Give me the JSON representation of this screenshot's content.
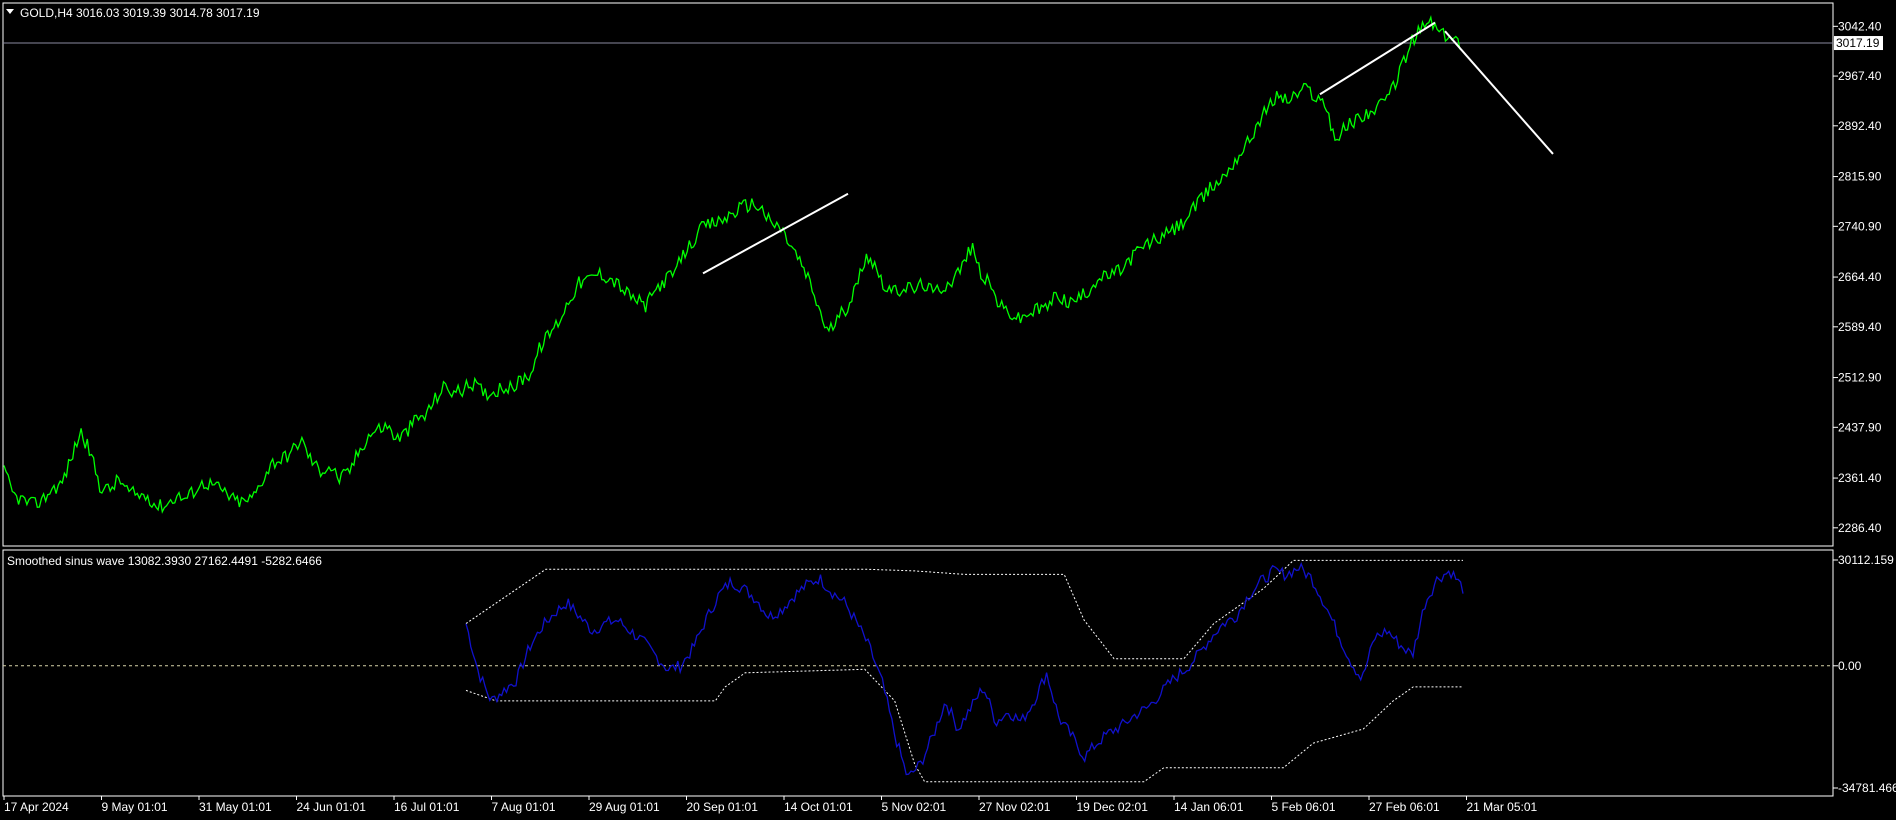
{
  "colors": {
    "background": "#000000",
    "price_line": "#00ff00",
    "indicator_line": "#1111cc",
    "band": "#ffffff",
    "grid_frame": "#ffffff",
    "zero_line": "#d6d2a8",
    "trendline": "#ffffff"
  },
  "main_panel": {
    "header": "GOLD,H4  3016.03 3019.39 3014.78 3017.19",
    "current_price": "3017.19",
    "y_ticks": [
      "3042.40",
      "2967.40",
      "2892.40",
      "2815.90",
      "2740.90",
      "2664.40",
      "2589.40",
      "2512.90",
      "2437.90",
      "2361.40",
      "2286.40"
    ]
  },
  "indicator_panel": {
    "header": "Smoothed sinus wave 13082.3930 27162.4491 -5282.6466",
    "y_ticks": [
      "30112.159",
      "0.00",
      "-34781.466"
    ]
  },
  "x_ticks": [
    "17 Apr 2024",
    "9 May 01:01",
    "31 May 01:01",
    "24 Jun 01:01",
    "16 Jul 01:01",
    "7 Aug 01:01",
    "29 Aug 01:01",
    "20 Sep 01:01",
    "14 Oct 01:01",
    "5 Nov 02:01",
    "27 Nov 02:01",
    "19 Dec 02:01",
    "14 Jan 06:01",
    "5 Feb 06:01",
    "27 Feb 06:01",
    "21 Mar 05:01"
  ],
  "chart_data": [
    {
      "type": "line",
      "title": "GOLD,H4",
      "x": [
        "17 Apr 2024",
        "9 May 01:01",
        "31 May 01:01",
        "24 Jun 01:01",
        "16 Jul 01:01",
        "7 Aug 01:01",
        "29 Aug 01:01",
        "20 Sep 01:01",
        "14 Oct 01:01",
        "5 Nov 02:01",
        "27 Nov 02:01",
        "19 Dec 02:01",
        "14 Jan 06:01",
        "5 Feb 06:01",
        "27 Feb 06:01",
        "21 Mar 05:01"
      ],
      "ylim": [
        2262,
        3070
      ],
      "series": [
        {
          "values": [
            2372,
            2335,
            2328,
            2321,
            2328,
            2345,
            2352,
            2390,
            2432,
            2400,
            2350,
            2343,
            2360,
            2340,
            2335,
            2335,
            2318,
            2322,
            2335,
            2330,
            2345,
            2355,
            2350,
            2340,
            2328,
            2325,
            2332,
            2360,
            2385,
            2390,
            2400,
            2420,
            2390,
            2372,
            2380,
            2360,
            2370,
            2400,
            2425,
            2435,
            2440,
            2420,
            2430,
            2450,
            2455,
            2480,
            2500,
            2490,
            2495,
            2505,
            2490,
            2490,
            2500,
            2495,
            2510,
            2520,
            2560,
            2580,
            2600,
            2630,
            2655,
            2660,
            2670,
            2665,
            2655,
            2640,
            2630,
            2620,
            2645,
            2660,
            2670,
            2700,
            2720,
            2740,
            2745,
            2750,
            2760,
            2770,
            2775,
            2770,
            2745,
            2740,
            2715,
            2690,
            2660,
            2620,
            2580,
            2600,
            2620,
            2650,
            2700,
            2680,
            2650,
            2640,
            2650,
            2645,
            2655,
            2640,
            2650,
            2660,
            2680,
            2710,
            2670,
            2650,
            2620,
            2610,
            2600,
            2610,
            2615,
            2620,
            2640,
            2625,
            2630,
            2640,
            2660,
            2665,
            2670,
            2680,
            2700,
            2710,
            2720,
            2725,
            2735,
            2745,
            2765,
            2780,
            2800,
            2810,
            2830,
            2850,
            2870,
            2900,
            2920,
            2940,
            2930,
            2940,
            2950,
            2935,
            2925,
            2870,
            2890,
            2900,
            2910,
            2915,
            2925,
            2950,
            2985,
            3020,
            3040,
            3050,
            3030,
            3025,
            3017
          ]
        }
      ],
      "trendlines": [
        {
          "from": [
            "20 Sep 01:01",
            2670
          ],
          "to": [
            "14 Oct 01:01",
            2790
          ]
        },
        {
          "from": [
            "5 Feb 06:01",
            2940
          ],
          "to": [
            "21 Mar 05:01",
            3048
          ]
        },
        {
          "from": [
            "21 Mar 05:01",
            3035
          ],
          "to": [
            "",
            2850
          ]
        }
      ],
      "current_value": 3017.19
    },
    {
      "type": "line",
      "title": "Smoothed sinus wave",
      "ylim": [
        -34781.466,
        30112.159
      ],
      "zero_line": 0,
      "series": [
        {
          "name": "Smoothed sinus wave",
          "values": [
            12000,
            -2000,
            -10000,
            -7000,
            -4000,
            5000,
            11000,
            15000,
            18000,
            14000,
            10000,
            12000,
            13000,
            10000,
            7000,
            3000,
            -1000,
            0,
            5000,
            13000,
            20000,
            24000,
            22000,
            19000,
            14000,
            16000,
            20000,
            23000,
            25000,
            21000,
            18000,
            12000,
            5000,
            -5000,
            -20000,
            -32000,
            -28000,
            -20000,
            -10000,
            -18000,
            -12000,
            -6000,
            -16000,
            -13000,
            -16000,
            -10000,
            -2000,
            -15000,
            -20000,
            -26000,
            -22000,
            -19000,
            -17000,
            -14000,
            -12000,
            -8000,
            -4000,
            -1000,
            3000,
            8000,
            12000,
            14000,
            20000,
            24000,
            27000,
            26000,
            28000,
            25000,
            18000,
            10000,
            2000,
            -4000,
            8000,
            10000,
            6000,
            3000,
            18000,
            25000,
            27000,
            22000
          ]
        },
        {
          "name": "upper band",
          "values": [
            12000,
            -5000,
            -10000,
            -9500,
            -9500,
            -9500,
            -9500,
            -9500,
            -9500,
            -9500,
            -9500,
            -9500,
            -9500,
            -9500,
            -9500,
            -9500,
            -9500,
            -9500,
            -9500,
            -4000,
            -4000,
            -4000,
            -4000,
            -4000,
            -4000,
            -4000,
            -4000,
            -4000,
            -4000,
            -4000,
            -4000,
            -4000,
            -4000,
            -4000
          ]
        }
      ],
      "upper_band": [
        [
          0.0,
          12000
        ],
        [
          0.08,
          27500
        ],
        [
          0.12,
          27500
        ],
        [
          0.2,
          27500
        ],
        [
          0.3,
          27500
        ],
        [
          0.4,
          27500
        ],
        [
          0.45,
          27000
        ],
        [
          0.5,
          26000
        ],
        [
          0.6,
          26000
        ],
        [
          0.62,
          13000
        ],
        [
          0.65,
          2000
        ],
        [
          0.72,
          2000
        ],
        [
          0.75,
          12000
        ],
        [
          0.8,
          22000
        ],
        [
          0.83,
          30000
        ],
        [
          1.0,
          30000
        ]
      ],
      "lower_band": [
        [
          0.0,
          -7000
        ],
        [
          0.03,
          -10000
        ],
        [
          0.25,
          -10000
        ],
        [
          0.26,
          -6000
        ],
        [
          0.28,
          -2000
        ],
        [
          0.4,
          -1000
        ],
        [
          0.43,
          -10000
        ],
        [
          0.45,
          -28000
        ],
        [
          0.46,
          -33000
        ],
        [
          0.68,
          -33000
        ],
        [
          0.7,
          -29000
        ],
        [
          0.82,
          -29000
        ],
        [
          0.85,
          -22000
        ],
        [
          0.9,
          -18000
        ],
        [
          0.93,
          -10000
        ],
        [
          0.95,
          -6000
        ],
        [
          1.0,
          -6000
        ]
      ]
    }
  ]
}
